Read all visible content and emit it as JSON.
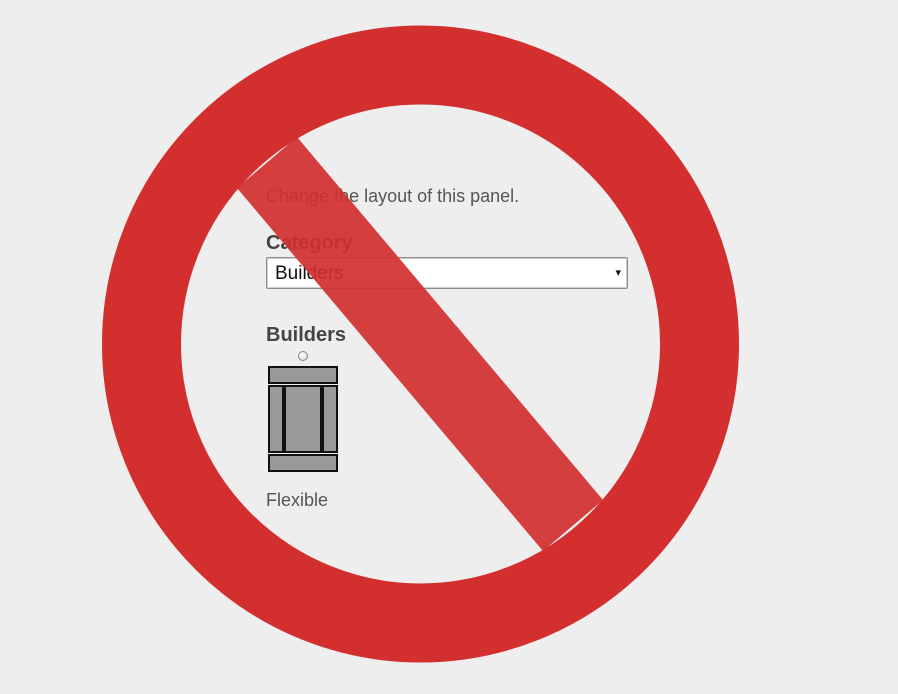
{
  "panel": {
    "intro_text": "Change the layout of this panel.",
    "category_label": "Category",
    "category_select": {
      "selected": "Builders",
      "arrow": "▾"
    },
    "section_heading": "Builders",
    "layout_options": [
      {
        "label": "Flexible",
        "selected": false
      }
    ]
  },
  "overlay": {
    "icon": "prohibition-sign",
    "color": "#d32f2f"
  },
  "colors": {
    "background": "#eeeeee",
    "text": "#555555",
    "heading": "#444444",
    "thumbnail_fill": "#999999",
    "thumbnail_border": "#111111"
  }
}
